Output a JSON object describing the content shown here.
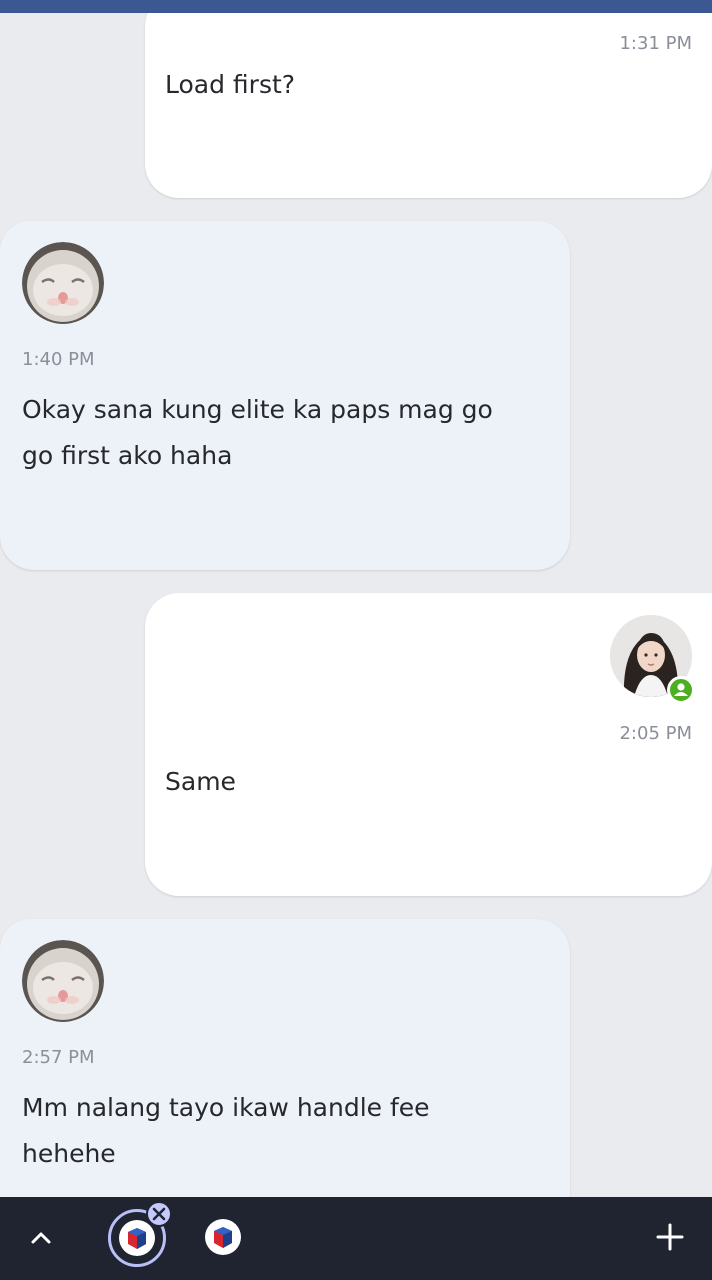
{
  "colors": {
    "header_bar": "#3b5892",
    "background": "#e9ebee",
    "sent_bubble": "#ffffff",
    "received_bubble": "#edf2f9",
    "online_dot": "#4caf1f",
    "nav_background": "#1f2430"
  },
  "messages": [
    {
      "direction": "sent",
      "time": "1:31 PM",
      "text": "Load first?"
    },
    {
      "direction": "received",
      "avatar": "cat-avatar",
      "time": "1:40 PM",
      "text": "Okay sana kung elite ka paps mag go go first ako haha"
    },
    {
      "direction": "sent",
      "avatar": "user-avatar",
      "online": true,
      "time": "2:05 PM",
      "text": "Same"
    },
    {
      "direction": "received",
      "avatar": "cat-avatar",
      "time": "2:57 PM",
      "text": "Mm nalang tayo ikaw handle fee hehehe"
    }
  ],
  "navbar": {
    "icons": [
      "chevron-up-icon",
      "app-tab-icon",
      "close-tab-icon",
      "app-tab-icon",
      "plus-icon"
    ]
  }
}
